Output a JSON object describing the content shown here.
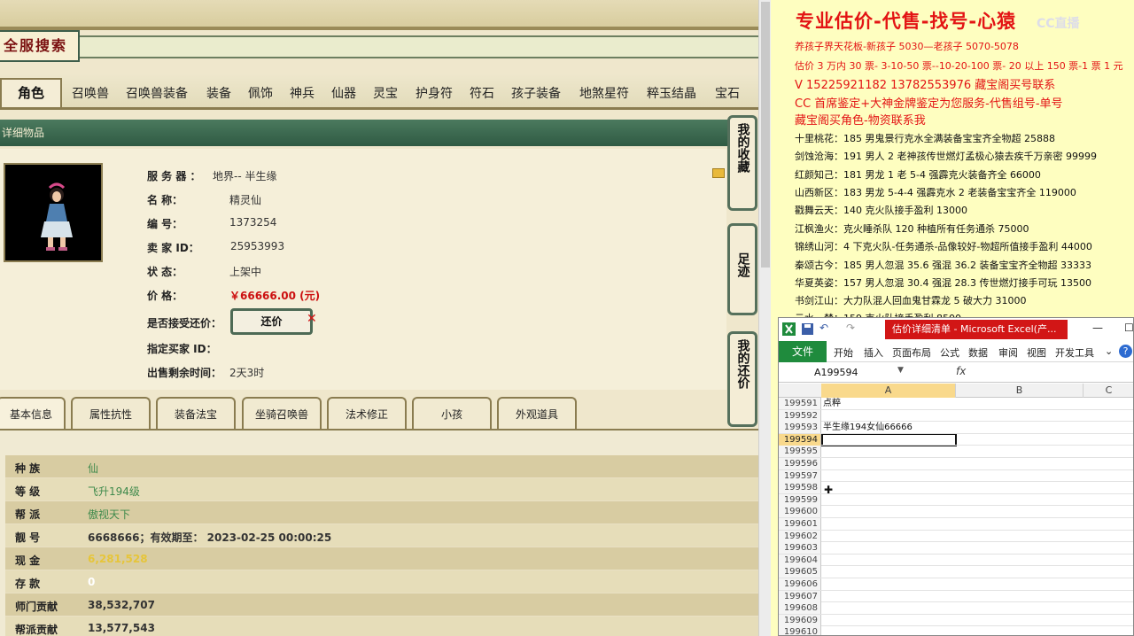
{
  "left": {
    "search_title": "全服搜索",
    "tabs": [
      "角色",
      "召唤兽",
      "召唤兽装备",
      "装备",
      "佩饰",
      "神兵",
      "仙器",
      "灵宝",
      "护身符",
      "符石",
      "孩子装备",
      "地煞星符",
      "粹玉结晶",
      "宝石"
    ],
    "section_header": "详细物品",
    "detail_rows": [
      {
        "label": "服 务 器 ：",
        "value": "地界-- 半生缘"
      },
      {
        "label": "名      称：",
        "value": "精灵仙"
      },
      {
        "label": "编      号：",
        "value": "1373254"
      },
      {
        "label": "卖  家   ID：",
        "value": "25953993"
      },
      {
        "label": "状      态：",
        "value": "上架中"
      },
      {
        "label": "价      格：",
        "value": "￥66666.00 (元)"
      },
      {
        "label": "是否接受还价：",
        "value": ""
      },
      {
        "label": "指定买家 ID：",
        "value": ""
      },
      {
        "label": "出售剩余时间：",
        "value": "2天3时"
      }
    ],
    "counter_button": "还价",
    "side_buttons": [
      "我的收藏",
      "足迹",
      "我的还价"
    ],
    "sub_tabs": [
      "基本信息",
      "属性抗性",
      "装备法宝",
      "坐骑召唤兽",
      "法术修正",
      "小孩",
      "外观道具"
    ],
    "stats": [
      {
        "label": "种    族",
        "value": "仙",
        "style": "v-green"
      },
      {
        "label": "等    级",
        "value": "飞升194级",
        "style": "v-green"
      },
      {
        "label": "帮    派",
        "value": "傲视天下",
        "style": "v-green"
      },
      {
        "label": "靓    号",
        "value": "6668666；有效期至： 2023-02-25 00:00:25",
        "style": "v-dark"
      },
      {
        "label": "现    金",
        "value": "6,281,528",
        "style": "v-yellow"
      },
      {
        "label": "存    款",
        "value": "0",
        "style": "v-white"
      },
      {
        "label": "师门贡献",
        "value": "38,532,707",
        "style": "v-dark"
      },
      {
        "label": "帮派贡献",
        "value": "13,577,543",
        "style": "v-dark"
      }
    ]
  },
  "right": {
    "title": "专业估价-代售-找号-心猿",
    "watermark": "CC直播",
    "red_lines": [
      "养孩子界天花板-新孩子 5030—老孩子 5070-5078",
      "估价 3 万内 30 票- 3-10-50 票--10-20-100 票- 20 以上 150 票-1 票 1 元",
      "V 15225921182      13782553976    藏宝阁买号联系",
      "CC 首席鉴定+大神金牌鉴定为您服务-代售组号-单号",
      "藏宝阁买角色-物资联系我"
    ],
    "list_lines": [
      "十里桃花：185 男鬼景行克水全满装备宝宝齐全物超 25888",
      "剑蚀沧海：191 男人 2 老神孩传世燃灯孟极心猿去疾千万亲密 99999",
      "红颜知己：181 男龙 1 老 5-4 强霹克火装备齐全 66000",
      "山西新区：183 男龙 5-4-4 强霹克水 2 老装备宝宝齐全 119000",
      "戳舞云天：140 克火队接手盈利 13000",
      "江枫渔火：克火睡杀队 120 种植所有任务通杀 75000",
      "锦绣山河：4 下克火队-任务通杀-品像较好-物超所值接手盈利 44000",
      "秦颂古今：185 男人忽混 35.6 强混 36.2 装备宝宝齐全物超 33333",
      "华夏英姿：157 男人忽混 30.4 强混 28.3 传世燃灯接手可玩 13500",
      "书剑江山：大力队混人回血鬼甘霖龙 5 破大力 31000",
      "云水一禁：159 克火队接手盈利 8500"
    ]
  },
  "excel": {
    "window_title": "估价详细清单 - Microsoft Excel(产...",
    "file_tab": "文件",
    "menu": [
      "开始",
      "插入",
      "页面布局",
      "公式",
      "数据",
      "审阅",
      "视图",
      "开发工具"
    ],
    "name_box": "A199594",
    "fx": "fx",
    "columns": [
      "A",
      "B",
      "C"
    ],
    "rows": [
      {
        "num": "199591",
        "a": "点粹"
      },
      {
        "num": "199592",
        "a": ""
      },
      {
        "num": "199593",
        "a": "半生缘194女仙66666"
      },
      {
        "num": "199594",
        "a": ""
      },
      {
        "num": "199595",
        "a": ""
      },
      {
        "num": "199596",
        "a": ""
      },
      {
        "num": "199597",
        "a": ""
      },
      {
        "num": "199598",
        "a": ""
      },
      {
        "num": "199599",
        "a": ""
      },
      {
        "num": "199600",
        "a": ""
      },
      {
        "num": "199601",
        "a": ""
      },
      {
        "num": "199602",
        "a": ""
      },
      {
        "num": "199603",
        "a": ""
      },
      {
        "num": "199604",
        "a": ""
      },
      {
        "num": "199605",
        "a": ""
      },
      {
        "num": "199606",
        "a": ""
      },
      {
        "num": "199607",
        "a": ""
      },
      {
        "num": "199608",
        "a": ""
      },
      {
        "num": "199609",
        "a": ""
      },
      {
        "num": "199610",
        "a": ""
      }
    ]
  }
}
